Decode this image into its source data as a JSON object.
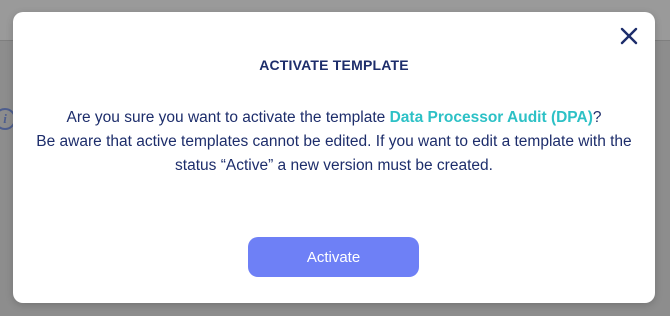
{
  "backdrop": {
    "info_icon_glyph": "i"
  },
  "modal": {
    "title": "ACTIVATE TEMPLATE",
    "message_line1_prefix": "Are you sure you want to activate the template ",
    "template_name": "Data Processor Audit (DPA)",
    "message_line1_suffix": "?",
    "message_line2": "Be aware that active templates cannot be edited. If you want to edit a template with the status “Active” a new version must be created.",
    "activate_label": "Activate",
    "close_icon": "close-icon"
  },
  "colors": {
    "title_text": "#1d2d6b",
    "highlight": "#2dc1c6",
    "button": "#6e80f6",
    "backdrop": "#8d8d8d"
  }
}
